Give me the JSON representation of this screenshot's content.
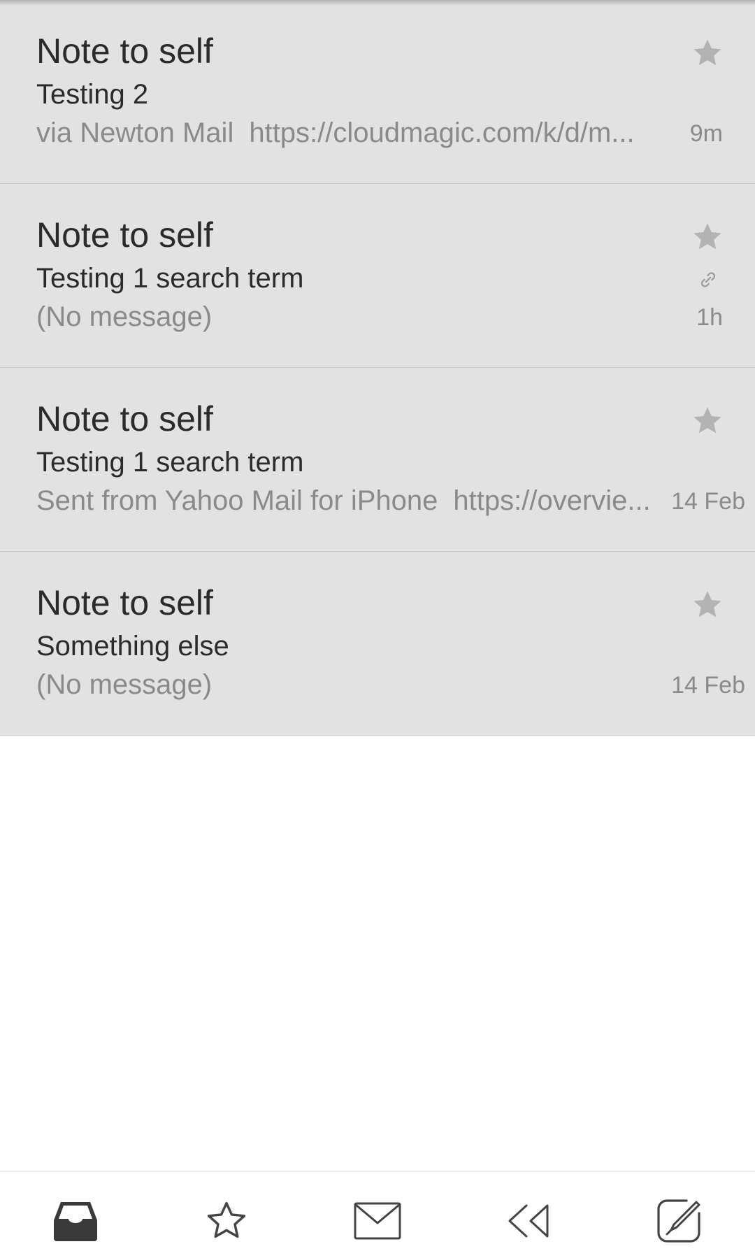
{
  "mail_items": [
    {
      "sender": "Note to self",
      "subject": "Testing 2",
      "preview_from": "via Newton Mail",
      "preview_link": "https://cloudmagic.com/k/d/m...",
      "time": "9m",
      "starred": false,
      "has_attachment": false
    },
    {
      "sender": "Note to self",
      "subject": "Testing 1 search term",
      "preview_from": "(No message)",
      "preview_link": "",
      "time": "1h",
      "starred": false,
      "has_attachment": true
    },
    {
      "sender": "Note to self",
      "subject": "Testing 1 search term",
      "preview_from": "Sent from Yahoo Mail for iPhone",
      "preview_link": "https://overvie...",
      "time": "14 Feb",
      "starred": false,
      "has_attachment": false
    },
    {
      "sender": "Note to self",
      "subject": "Something else",
      "preview_from": "(No message)",
      "preview_link": "",
      "time": "14 Feb",
      "starred": false,
      "has_attachment": false
    }
  ],
  "bottom_nav": {
    "items": [
      {
        "icon": "inbox-icon",
        "active": true
      },
      {
        "icon": "star-outline-icon",
        "active": false
      },
      {
        "icon": "envelope-icon",
        "active": false
      },
      {
        "icon": "reply-all-icon",
        "active": false
      },
      {
        "icon": "compose-icon",
        "active": false
      }
    ]
  },
  "colors": {
    "item_background": "#e2e2e2",
    "primary_text": "#2b2b2b",
    "secondary_text": "#8a8a8a",
    "star_gray": "#b3b3b3",
    "icon_dark": "#444444"
  }
}
